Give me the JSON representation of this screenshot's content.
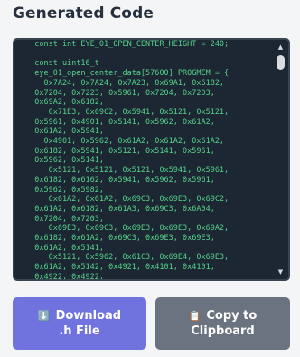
{
  "panel": {
    "title": "Generated Code"
  },
  "code": {
    "text": "  const int EYE_01_OPEN_CENTER_HEIGHT = 240;\n\n  const uint16_t\n  eye_01_open_center_data[57600] PROGMEM = {\n    0x7A24, 0x7A24, 0x7A23, 0x69A1, 0x6182,\n  0x7204, 0x7223, 0x5961, 0x7204, 0x7203,\n  0x69A2, 0x6182,\n     0x71E3, 0x69C2, 0x5941, 0x5121, 0x5121,\n  0x5961, 0x4901, 0x5141, 0x5962, 0x61A2,\n  0x61A2, 0x5941,\n    0x4901, 0x5962, 0x61A2, 0x61A2, 0x61A2,\n  0x6182, 0x5941, 0x5121, 0x5141, 0x5961,\n  0x5962, 0x5141,\n     0x5121, 0x5121, 0x5121, 0x5941, 0x5961,\n  0x6182, 0x6162, 0x5941, 0x5962, 0x5961,\n  0x5962, 0x5982,\n     0x61A2, 0x61A2, 0x69C3, 0x69E3, 0x69C2,\n  0x61A2, 0x6182, 0x61A3, 0x69C3, 0x6A04,\n  0x7204, 0x7203,\n     0x69E3, 0x69C3, 0x69E3, 0x69E3, 0x69A2,\n  0x6182, 0x61A2, 0x69C3, 0x69E3, 0x69E3,\n  0x61A2, 0x5141,\n     0x5121, 0x5962, 0x61C3, 0x69E4, 0x69E3,\n  0x61A2, 0x5142, 0x4921, 0x4101, 0x4101,\n  0x4922, 0x4922,"
  },
  "buttons": {
    "download": {
      "icon": "⬇️",
      "line1": "Download",
      "line2": ".h File"
    },
    "copy": {
      "icon": "📋",
      "line1": "Copy to",
      "line2": "Clipboard"
    }
  },
  "icons": {
    "download": "download-arrow-icon",
    "copy": "clipboard-icon"
  },
  "colors": {
    "code_bg": "#1c2733",
    "code_text": "#55d48a",
    "download_button": "#7073dd",
    "copy_button": "#6b7380"
  }
}
